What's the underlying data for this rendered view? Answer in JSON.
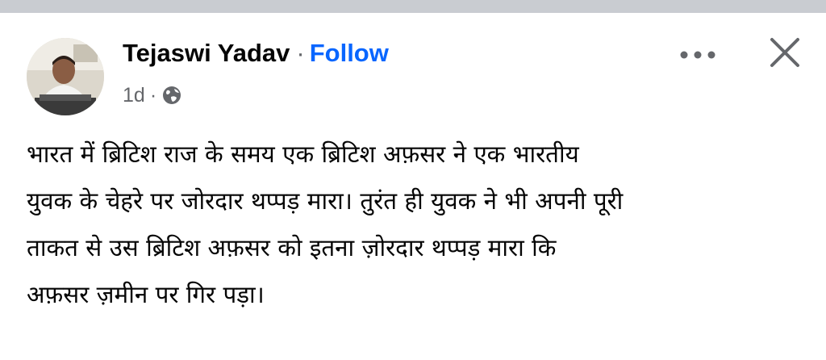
{
  "post": {
    "author": "Tejaswi Yadav",
    "separator": "·",
    "follow_label": "Follow",
    "timestamp": "1d",
    "meta_separator": "·",
    "audience_icon": "globe-icon",
    "more_icon": "more-options-icon",
    "close_icon": "close-icon",
    "text_lines": [
      "भारत में ब्रिटिश राज के समय एक ब्रिटिश अफ़सर ने एक भारतीय",
      "युवक के चेहरे पर जोरदार थप्पड़ मारा। तुरंत ही युवक ने भी अपनी पूरी",
      "ताकत से उस ब्रिटिश अफ़सर को इतना ज़ोरदार थप्पड़ मारा कि",
      "अफ़सर ज़मीन पर गिर पड़ा।"
    ]
  },
  "colors": {
    "follow": "#0866ff",
    "secondary_text": "#65676b",
    "top_strip": "#c9ccd1"
  }
}
